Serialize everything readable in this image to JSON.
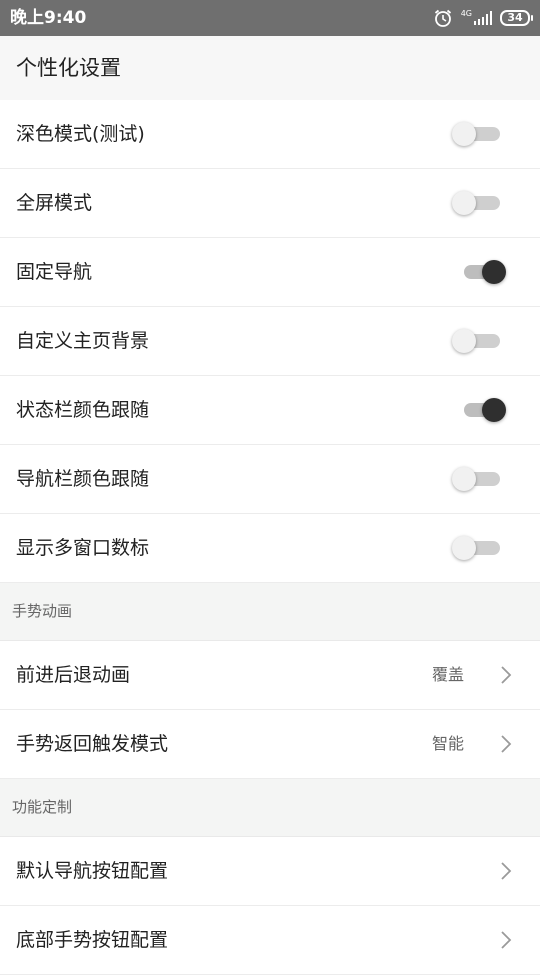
{
  "status_bar": {
    "time": "晚上9:40",
    "network": "4G",
    "battery": "34",
    "icons": [
      "alarm-icon",
      "signal-icon",
      "battery-icon"
    ]
  },
  "header": {
    "title": "个性化设置"
  },
  "toggles": [
    {
      "label": "深色模式(测试)",
      "on": false
    },
    {
      "label": "全屏模式",
      "on": false
    },
    {
      "label": "固定导航",
      "on": true
    },
    {
      "label": "自定义主页背景",
      "on": false
    },
    {
      "label": "状态栏颜色跟随",
      "on": true
    },
    {
      "label": "导航栏颜色跟随",
      "on": false
    },
    {
      "label": "显示多窗口数标",
      "on": false
    }
  ],
  "sections": [
    {
      "title": "手势动画",
      "items": [
        {
          "label": "前进后退动画",
          "value": "覆盖"
        },
        {
          "label": "手势返回触发模式",
          "value": "智能"
        }
      ]
    },
    {
      "title": "功能定制",
      "items": [
        {
          "label": "默认导航按钮配置",
          "value": ""
        },
        {
          "label": "底部手势按钮配置",
          "value": ""
        }
      ]
    }
  ],
  "colors": {
    "status_bar": "#6f6f6f",
    "switch_on_knob": "#2f2f2f",
    "switch_off_knob": "#f1f1f1",
    "section_bg": "#f4f5f4"
  }
}
